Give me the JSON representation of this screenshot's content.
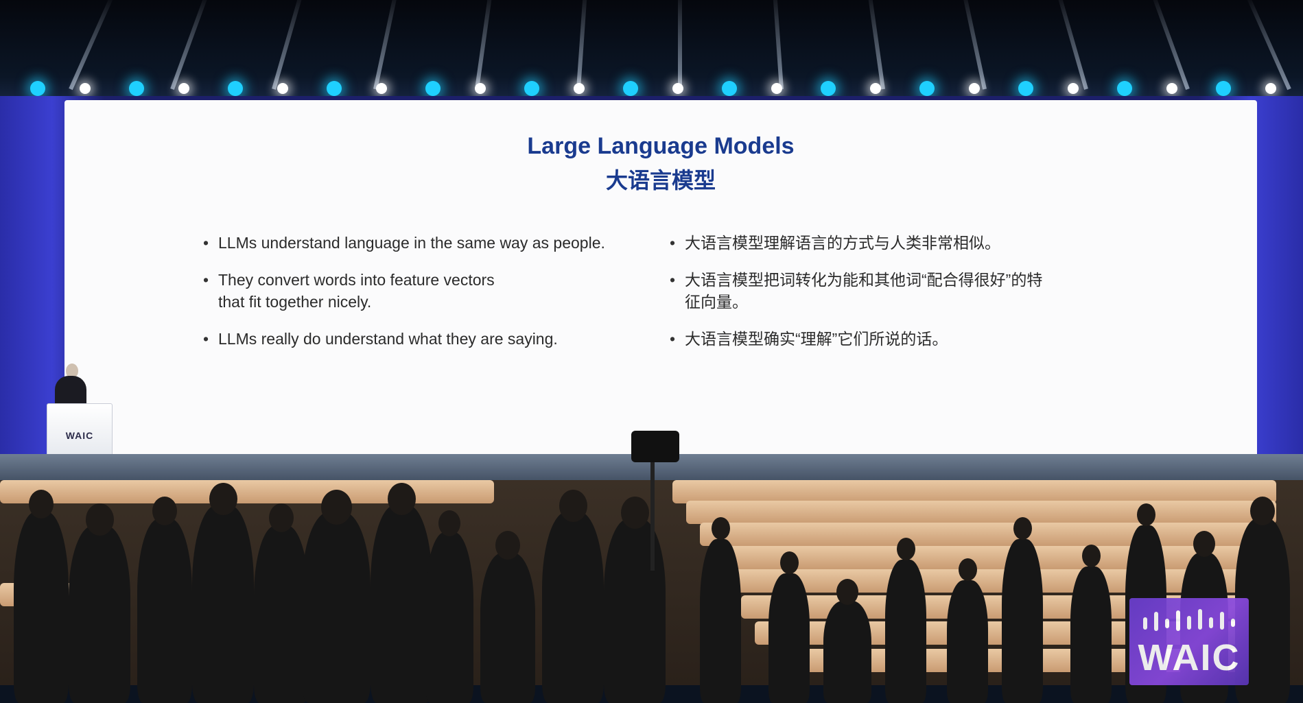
{
  "slide": {
    "title_en": "Large Language Models",
    "title_zh": "大语言模型",
    "bullets_en": [
      {
        "lines": [
          "LLMs understand language in the same way as people."
        ]
      },
      {
        "lines": [
          "They convert words into feature vectors",
          "that fit together nicely."
        ]
      },
      {
        "lines": [
          "LLMs really do understand what they are saying."
        ]
      }
    ],
    "bullets_zh": [
      {
        "lines": [
          "大语言模型理解语言的方式与人类非常相似。"
        ]
      },
      {
        "lines": [
          "大语言模型把词转化为能和其他词“配合得很好”的特",
          "征向量。"
        ]
      },
      {
        "lines": [
          "大语言模型确实“理解”它们所说的话。"
        ]
      }
    ],
    "bullet_glyph": "•",
    "title_color": "#1a3b8f"
  },
  "podium": {
    "logo_text": "WAIC"
  },
  "overlay_badge": {
    "text": "WAIC",
    "color": "#7a45d8"
  },
  "stage": {
    "accent_color": "#3b3fd0",
    "light_color": "#1fd0ff"
  }
}
